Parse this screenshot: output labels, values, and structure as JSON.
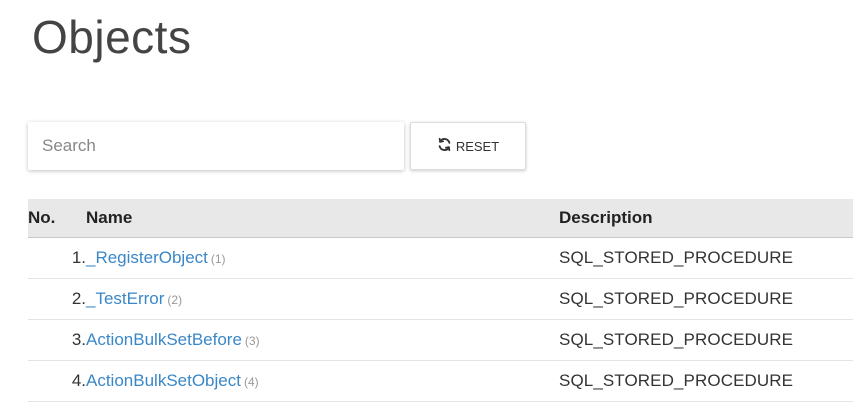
{
  "page": {
    "title": "Objects"
  },
  "search": {
    "placeholder": "Search",
    "value": ""
  },
  "reset_button": {
    "label": "RESET",
    "icon": "refresh-icon"
  },
  "table": {
    "columns": {
      "no": "No.",
      "name": "Name",
      "description": "Description"
    },
    "rows": [
      {
        "no": "1.",
        "name": "_RegisterObject",
        "count": "(1)",
        "description": "SQL_STORED_PROCEDURE"
      },
      {
        "no": "2.",
        "name": "_TestError",
        "count": "(2)",
        "description": "SQL_STORED_PROCEDURE"
      },
      {
        "no": "3.",
        "name": "ActionBulkSetBefore",
        "count": "(3)",
        "description": "SQL_STORED_PROCEDURE"
      },
      {
        "no": "4.",
        "name": "ActionBulkSetObject",
        "count": "(4)",
        "description": "SQL_STORED_PROCEDURE"
      }
    ]
  },
  "colors": {
    "link": "#3a87c8",
    "header_bg": "#e8e8e8",
    "count_gray": "#999999"
  }
}
